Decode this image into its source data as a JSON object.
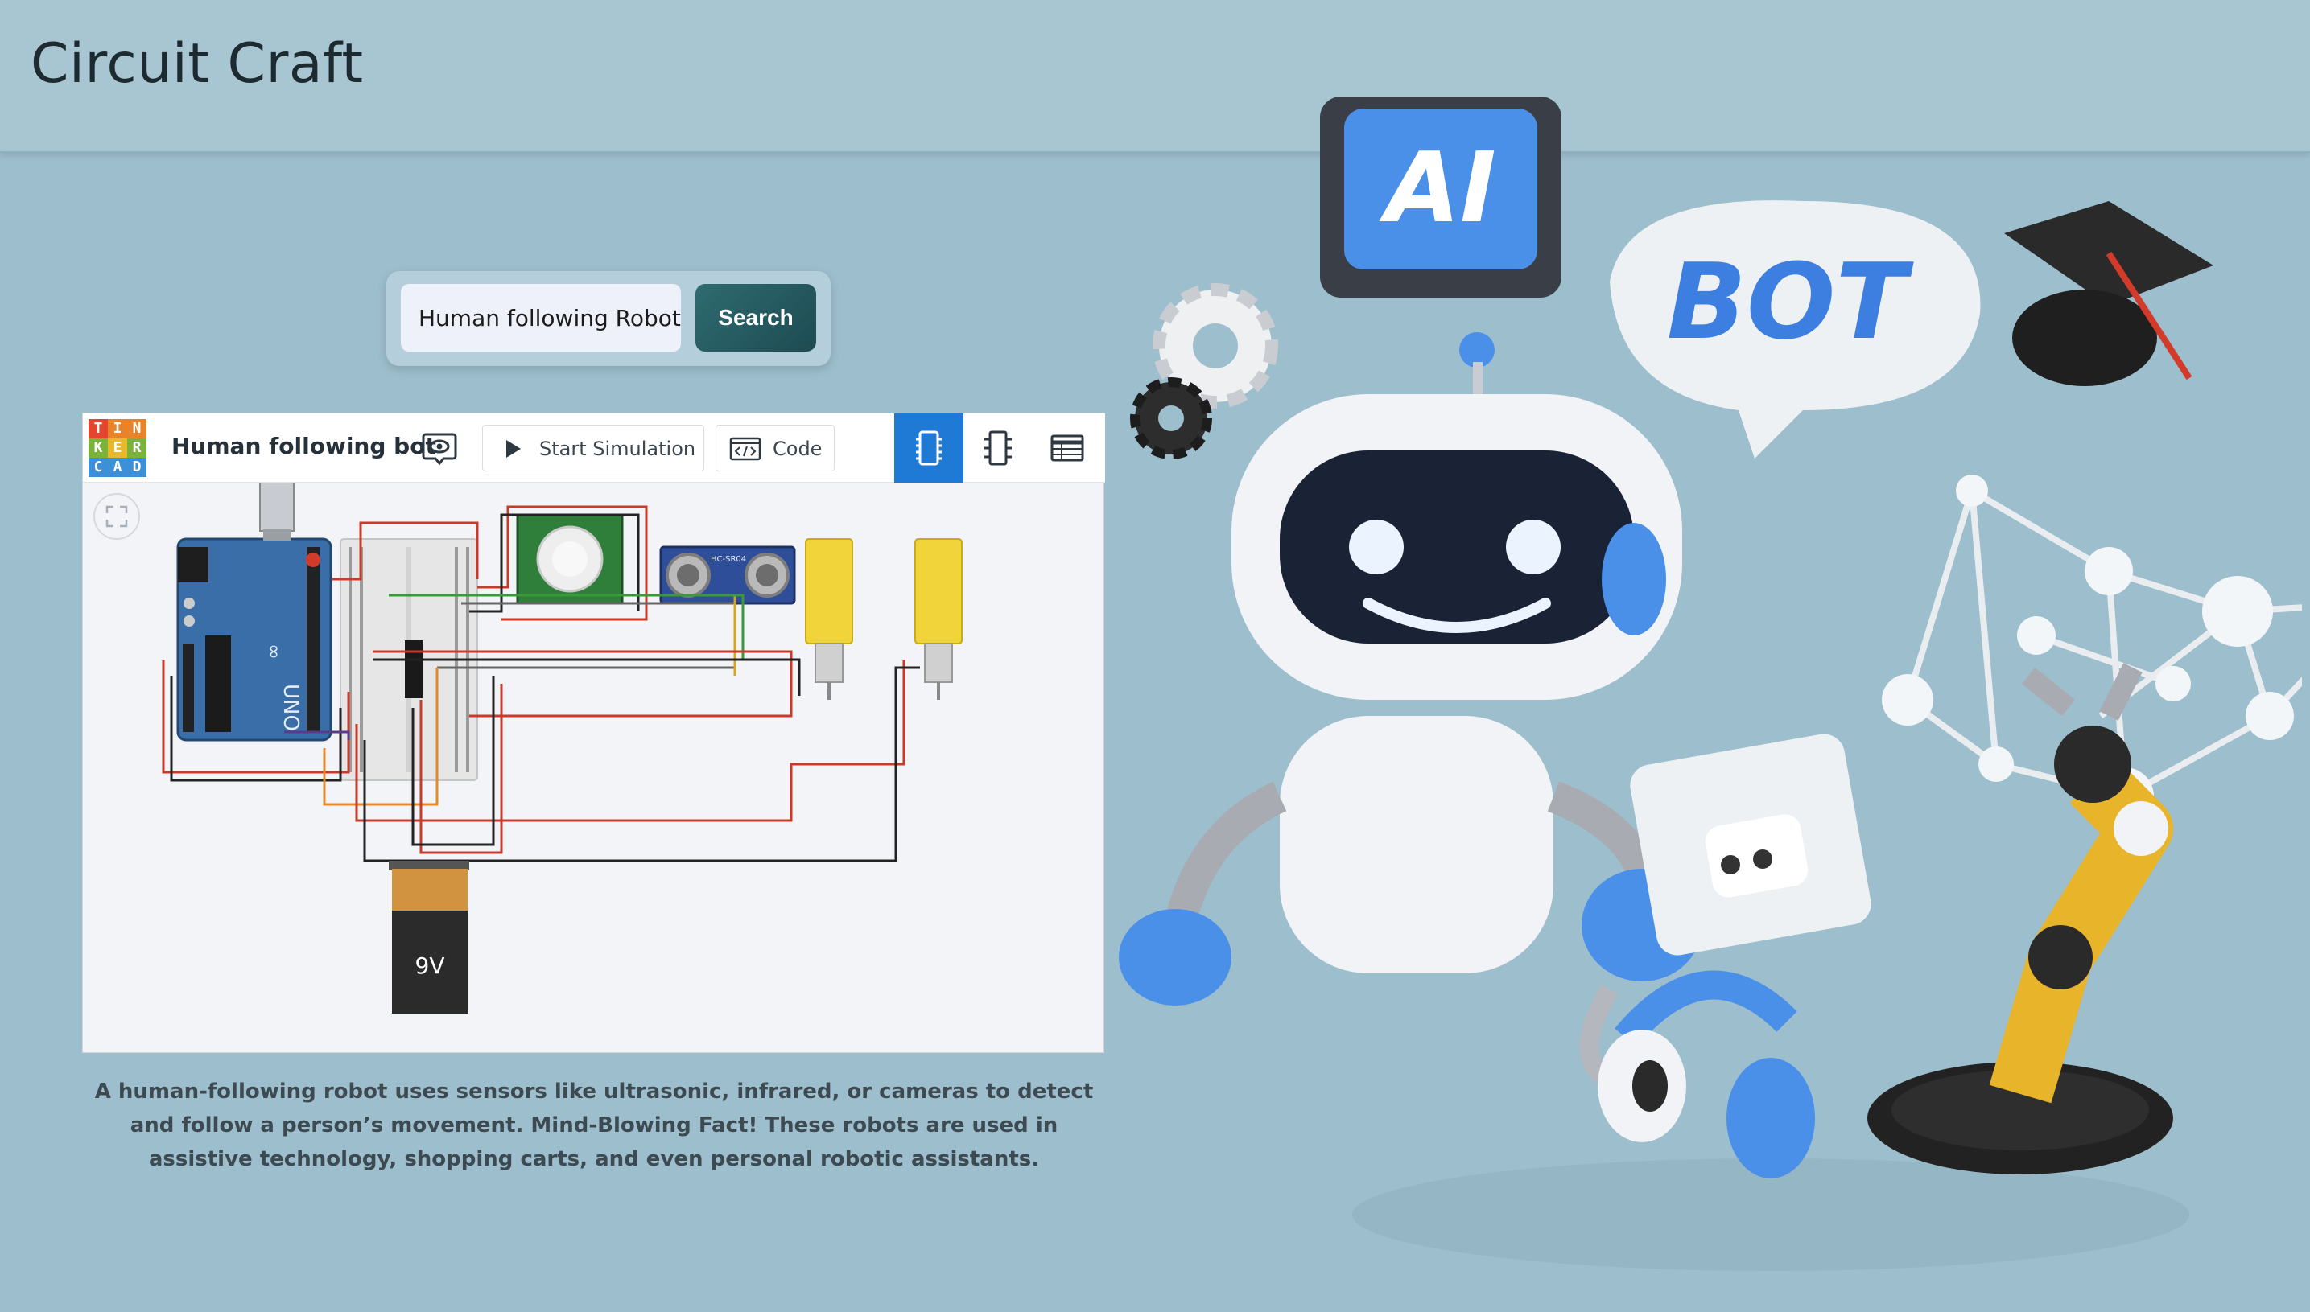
{
  "app": {
    "title": "Circuit Craft"
  },
  "search": {
    "value": "Human following Robot",
    "button_label": "Search"
  },
  "tinkercad": {
    "logo_letters": [
      "T",
      "I",
      "N",
      "K",
      "E",
      "R",
      "C",
      "A",
      "D"
    ],
    "project_name": "Human following bot",
    "start_simulation_label": "Start Simulation",
    "code_label": "Code",
    "views": [
      "circuit-view",
      "schematic-view",
      "component-list-view"
    ],
    "active_view": "circuit-view",
    "battery_label": "9V",
    "sensor_label": "HC-SR04"
  },
  "description": "A human-following robot uses sensors like ultrasonic, infrared, or cameras to detect and follow a person’s movement. Mind-Blowing Fact! These robots are used in assistive technology, shopping carts, and even personal robotic assistants.",
  "illustration": {
    "chip_text": "AI",
    "bubble_text": "BOT"
  },
  "colors": {
    "page_bg": "#9dbecd",
    "header_bg": "#a8c5d2",
    "search_button": "#1d4b52",
    "accent_blue": "#1f7ad6",
    "robot_blue": "#3d7fe0"
  }
}
